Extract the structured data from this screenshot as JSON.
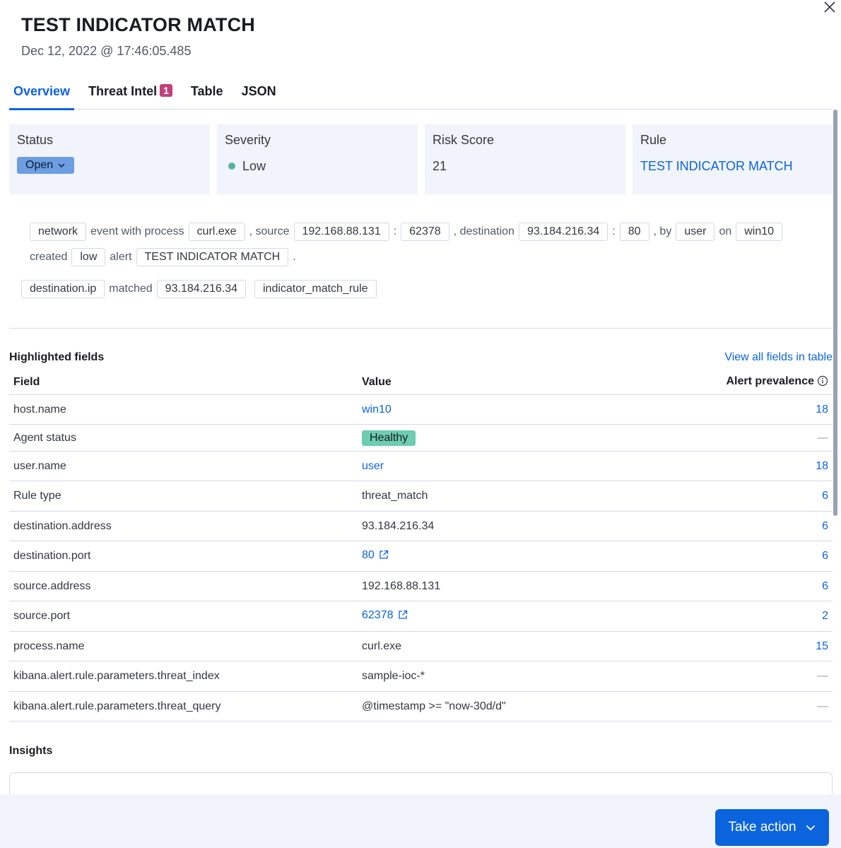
{
  "header": {
    "title": "TEST INDICATOR MATCH",
    "timestamp": "Dec 12, 2022 @ 17:46:05.485"
  },
  "tabs": [
    {
      "label": "Overview",
      "active": true
    },
    {
      "label": "Threat Intel",
      "badge": "1"
    },
    {
      "label": "Table"
    },
    {
      "label": "JSON"
    }
  ],
  "cards": {
    "status": {
      "label": "Status",
      "value": "Open"
    },
    "severity": {
      "label": "Severity",
      "value": "Low",
      "color": "#54b399"
    },
    "risk": {
      "label": "Risk Score",
      "value": "21"
    },
    "rule": {
      "label": "Rule",
      "value": "TEST INDICATOR MATCH"
    }
  },
  "reason": {
    "line1": [
      "network",
      "event with process",
      "curl.exe",
      ", source",
      "192.168.88.131",
      ":",
      "62378",
      ", destination",
      "93.184.216.34",
      ":",
      "80",
      ", by",
      "user",
      "on",
      "win10"
    ],
    "line2": [
      "created",
      "low",
      "alert",
      "TEST INDICATOR MATCH",
      "."
    ],
    "line3": [
      "destination.ip",
      "matched",
      "93.184.216.34",
      "indicator_match_rule"
    ]
  },
  "highlighted": {
    "title": "Highlighted fields",
    "view_all": "View all fields in table",
    "columns": {
      "field": "Field",
      "value": "Value",
      "prevalence": "Alert prevalence"
    },
    "rows": [
      {
        "field": "host.name",
        "value": "win10",
        "prevalence": "18"
      },
      {
        "field": "Agent status",
        "value": "Healthy",
        "prevalence": "—"
      },
      {
        "field": "user.name",
        "value": "user",
        "prevalence": "18"
      },
      {
        "field": "Rule type",
        "value": "threat_match",
        "prevalence": "6"
      },
      {
        "field": "destination.address",
        "value": "93.184.216.34",
        "prevalence": "6"
      },
      {
        "field": "destination.port",
        "value": "80",
        "prevalence": "6"
      },
      {
        "field": "source.address",
        "value": "192.168.88.131",
        "prevalence": "6"
      },
      {
        "field": "source.port",
        "value": "62378",
        "prevalence": "2"
      },
      {
        "field": "process.name",
        "value": "curl.exe",
        "prevalence": "15"
      },
      {
        "field": "kibana.alert.rule.parameters.threat_index",
        "value": "sample-ioc-*",
        "prevalence": "—"
      },
      {
        "field": "kibana.alert.rule.parameters.threat_query",
        "value": "@timestamp >= \"now-30d/d\"",
        "prevalence": "—"
      }
    ]
  },
  "insights": {
    "title": "Insights"
  },
  "footer": {
    "take_action": "Take action"
  }
}
